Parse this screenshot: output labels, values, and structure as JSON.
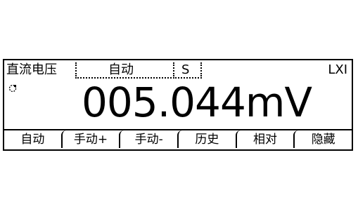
{
  "status": {
    "mode": "直流电压",
    "range": "自动",
    "speed": "S",
    "interface": "LXI"
  },
  "trigger_indicator": "trigger-status-icon",
  "reading": {
    "value": "005.044",
    "unit": "mV"
  },
  "softkeys": [
    "自动",
    "手动+",
    "手动-",
    "历史",
    "相对",
    "隐藏"
  ]
}
